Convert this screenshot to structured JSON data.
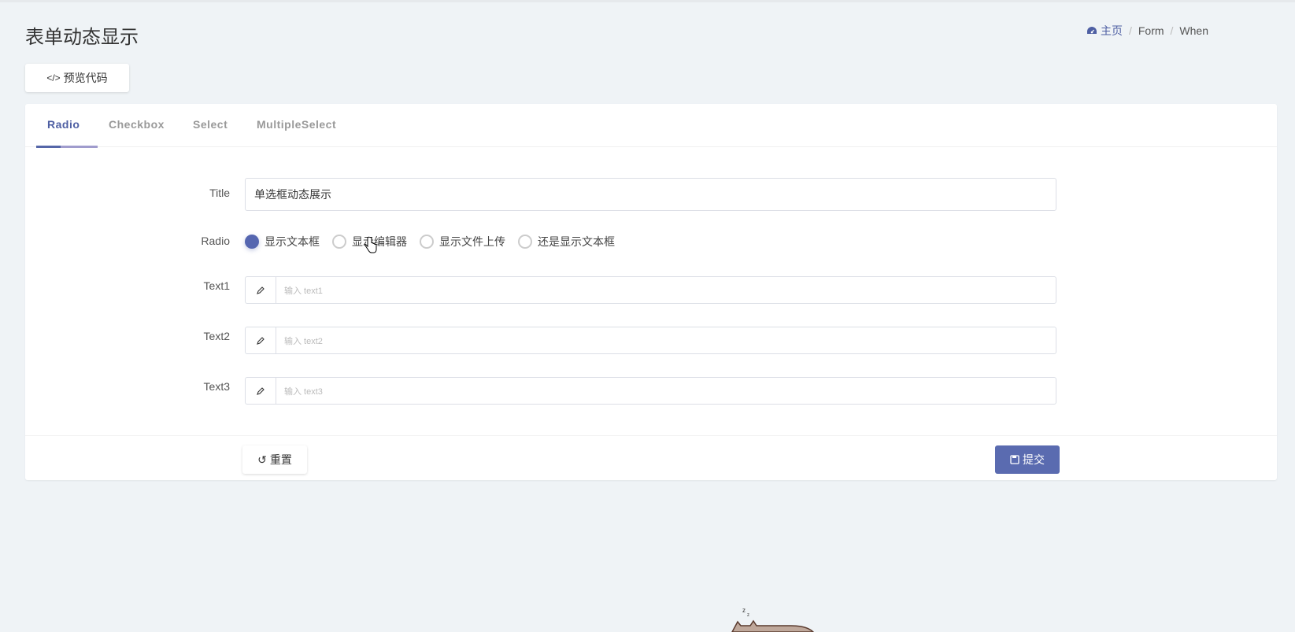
{
  "header": {
    "title": "表单动态显示"
  },
  "breadcrumb": {
    "home": "主页",
    "items": [
      "Form",
      "When"
    ]
  },
  "toolbar": {
    "preview_label": "预览代码"
  },
  "tabs": [
    {
      "label": "Radio",
      "active": true
    },
    {
      "label": "Checkbox"
    },
    {
      "label": "Select"
    },
    {
      "label": "MultipleSelect"
    }
  ],
  "form": {
    "title": {
      "label": "Title",
      "value": "单选框动态展示"
    },
    "radio": {
      "label": "Radio",
      "options": [
        "显示文本框",
        "显示编辑器",
        "显示文件上传",
        "还是显示文本框"
      ],
      "selected": "显示文本框"
    },
    "text1": {
      "label": "Text1",
      "placeholder": "输入 text1"
    },
    "text2": {
      "label": "Text2",
      "placeholder": "输入 text2"
    },
    "text3": {
      "label": "Text3",
      "placeholder": "输入 text3"
    }
  },
  "footer": {
    "reset_label": "重置",
    "submit_label": "提交"
  },
  "colors": {
    "primary": "#5a6bb0",
    "background": "#eff3f6"
  }
}
